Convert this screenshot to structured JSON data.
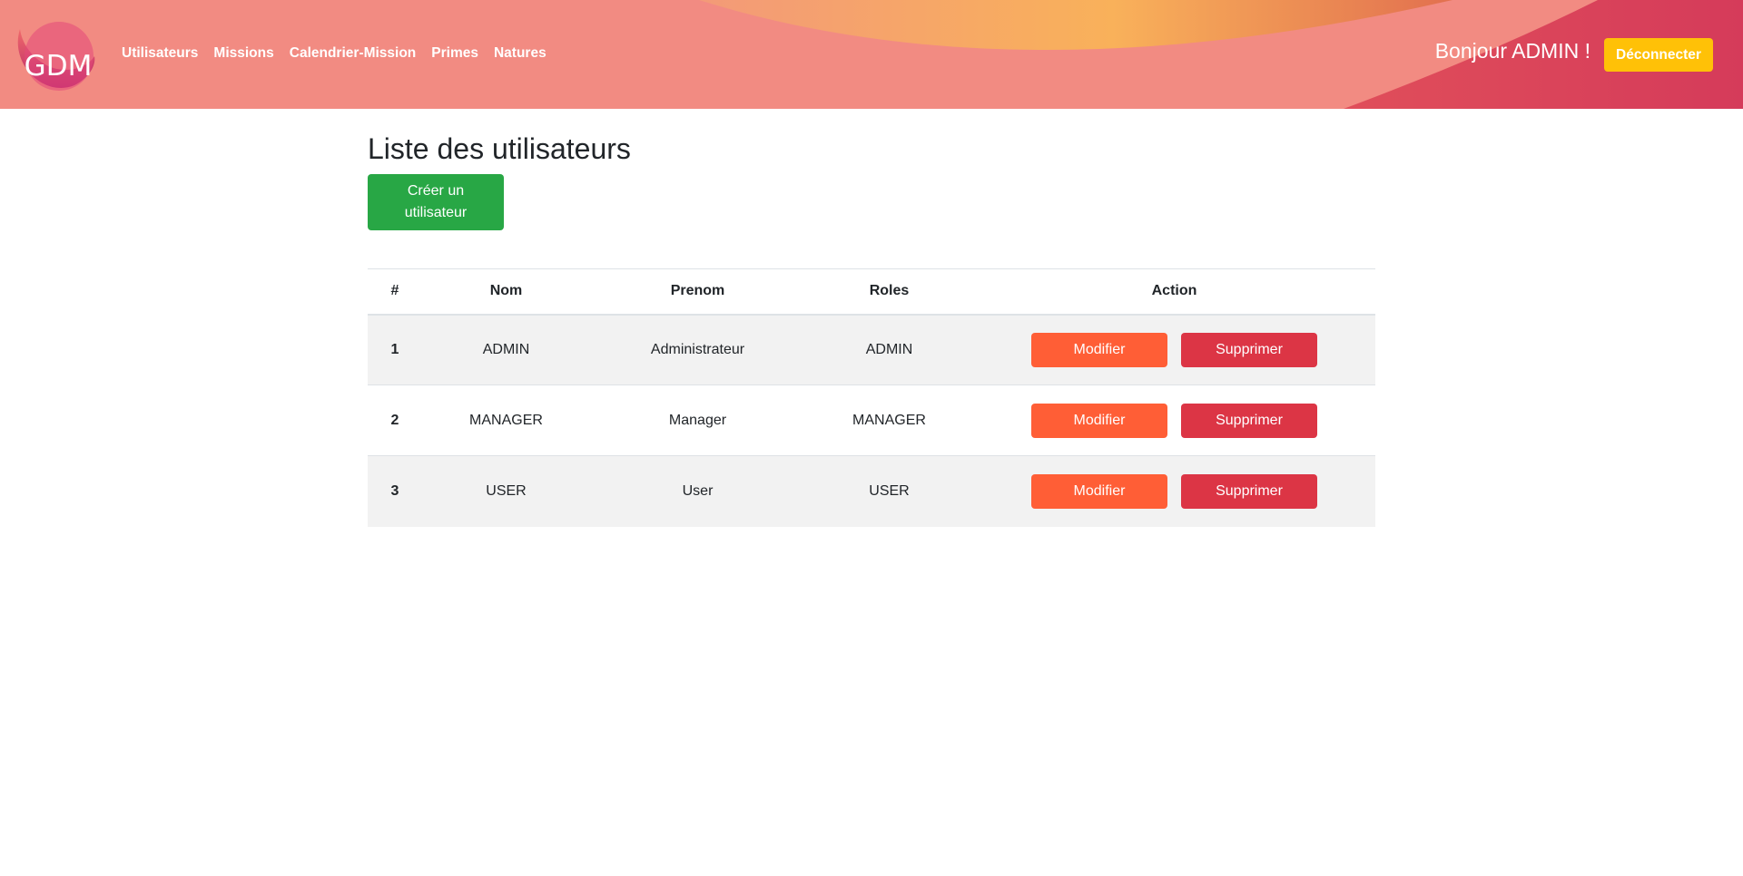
{
  "header": {
    "logo_text": "GDM",
    "nav": [
      "Utilisateurs",
      "Missions",
      "Calendrier-Mission",
      "Primes",
      "Natures"
    ],
    "greeting": "Bonjour ADMIN !",
    "logout_label": "Déconnecter"
  },
  "main": {
    "title": "Liste des utilisateurs",
    "create_label": "Créer un utilisateur",
    "table": {
      "headers": [
        "#",
        "Nom",
        "Prenom",
        "Roles",
        "Action"
      ],
      "rows": [
        {
          "id": "1",
          "nom": "ADMIN",
          "prenom": "Administrateur",
          "roles": "ADMIN",
          "edit": "Modifier",
          "delete": "Supprimer"
        },
        {
          "id": "2",
          "nom": "MANAGER",
          "prenom": "Manager",
          "roles": "MANAGER",
          "edit": "Modifier",
          "delete": "Supprimer"
        },
        {
          "id": "3",
          "nom": "USER",
          "prenom": "User",
          "roles": "USER",
          "edit": "Modifier",
          "delete": "Supprimer"
        }
      ]
    }
  },
  "colors": {
    "header_pink": "#f28b82",
    "header_orange": "#f9b15a",
    "header_red": "#d53b5a",
    "create_green": "#28a745",
    "logout_yellow": "#ffc107",
    "edit_orange": "#ff5e36",
    "delete_red": "#dc3545",
    "row_stripe": "#f2f2f2"
  }
}
